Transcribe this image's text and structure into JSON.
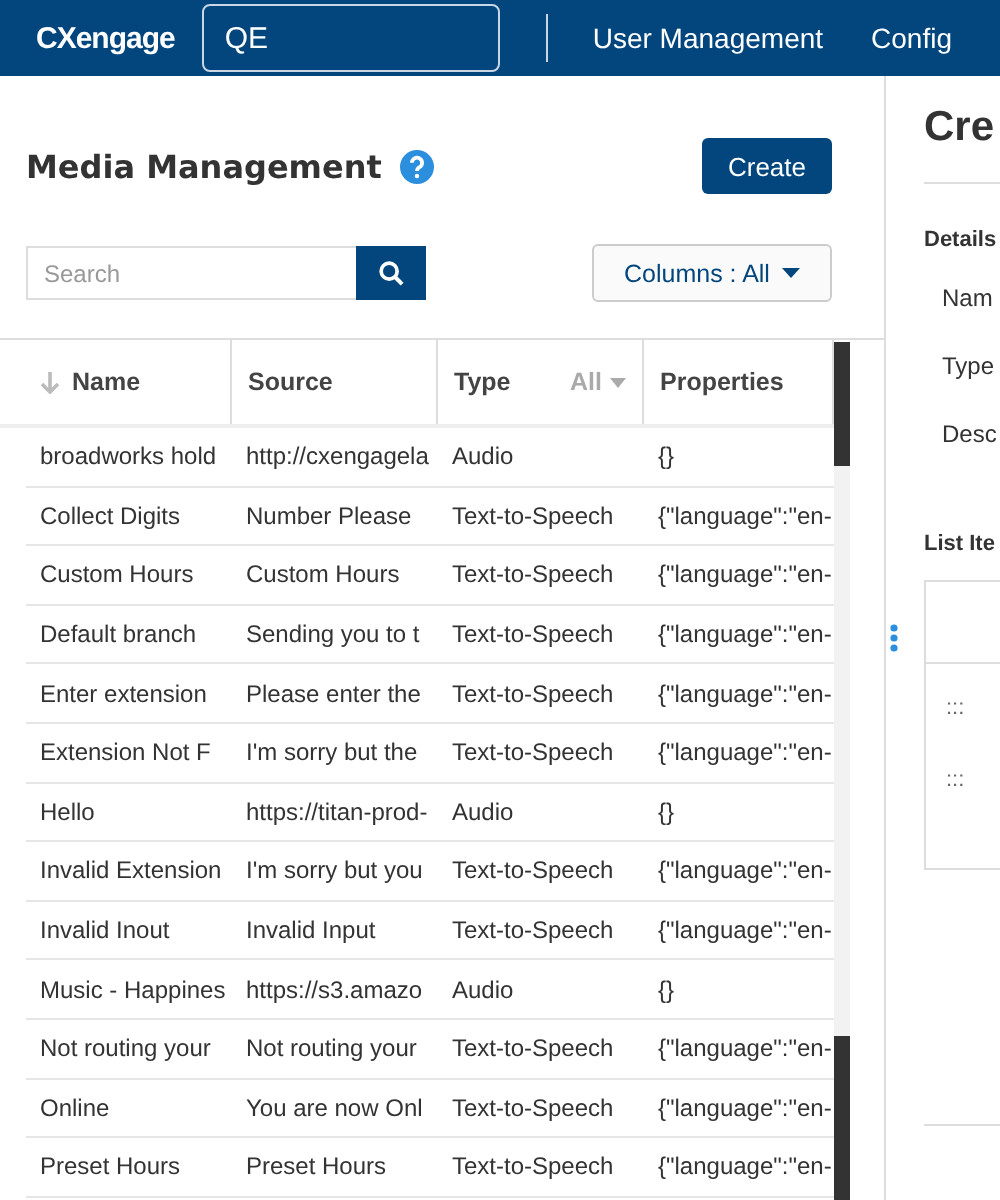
{
  "header": {
    "logo": "CXengage",
    "tenant": "QE",
    "nav": [
      "User Management",
      "Config"
    ]
  },
  "main": {
    "title": "Media Management",
    "create_button": "Create",
    "search": {
      "placeholder": "Search"
    },
    "columns_button": "Columns : All",
    "table": {
      "columns": [
        {
          "label": "Name",
          "sorted": true
        },
        {
          "label": "Source",
          "sorted": false
        },
        {
          "label": "Type",
          "sorted": false,
          "filter": "All"
        },
        {
          "label": "Properties",
          "sorted": false
        }
      ],
      "rows": [
        [
          "broadworks hold",
          "http://cxengagela",
          "Audio",
          "{}"
        ],
        [
          "Collect Digits",
          "Number Please",
          "Text-to-Speech",
          "{\"language\":\"en-"
        ],
        [
          "Custom Hours",
          "Custom Hours",
          "Text-to-Speech",
          "{\"language\":\"en-"
        ],
        [
          "Default branch",
          "Sending you to t",
          "Text-to-Speech",
          "{\"language\":\"en-"
        ],
        [
          "Enter extension",
          "Please enter the",
          "Text-to-Speech",
          "{\"language\":\"en-"
        ],
        [
          "Extension Not F",
          "I'm sorry but the",
          "Text-to-Speech",
          "{\"language\":\"en-"
        ],
        [
          "Hello",
          "https://titan-prod-",
          "Audio",
          "{}"
        ],
        [
          "Invalid Extension",
          "I'm sorry but you",
          "Text-to-Speech",
          "{\"language\":\"en-"
        ],
        [
          "Invalid Inout",
          "Invalid Input",
          "Text-to-Speech",
          "{\"language\":\"en-"
        ],
        [
          "Music - Happines",
          "https://s3.amazo",
          "Audio",
          "{}"
        ],
        [
          "Not routing your",
          "Not routing your",
          "Text-to-Speech",
          "{\"language\":\"en-"
        ],
        [
          "Online",
          "You are now Onl",
          "Text-to-Speech",
          "{\"language\":\"en-"
        ],
        [
          "Preset Hours",
          "Preset Hours",
          "Text-to-Speech",
          "{\"language\":\"en-"
        ]
      ]
    }
  },
  "side": {
    "title": "Cre",
    "section": "Details",
    "fields": [
      "Nam",
      "Type",
      "Desc"
    ],
    "list_title": "List Ite",
    "list_handles": [
      ":::",
      ":::"
    ]
  }
}
